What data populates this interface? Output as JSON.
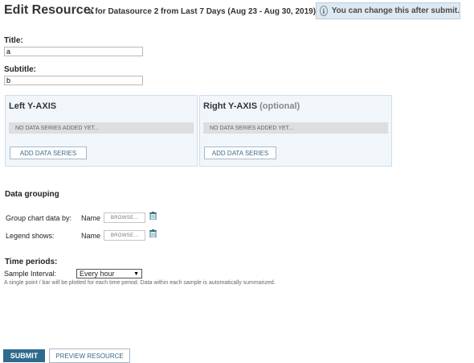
{
  "header": {
    "title": "Edit Resource:",
    "subtitle": "a for Datasource 2 from Last 7 Days (Aug 23 - Aug 30, 2019)",
    "info_text": "You can change this after submit.",
    "info_icon": "info-icon"
  },
  "form": {
    "title_label": "Title:",
    "title_value": "a",
    "subtitle_label": "Subtitle:",
    "subtitle_value": "b"
  },
  "axes": {
    "left": {
      "heading": "Left Y-AXIS",
      "empty_text": "No data series added yet...",
      "add_button": "ADD DATA SERIES"
    },
    "right": {
      "heading": "Right Y-AXIS",
      "optional": "(optional)",
      "empty_text": "No data series added yet...",
      "add_button": "ADD DATA SERIES"
    }
  },
  "grouping": {
    "heading": "Data grouping",
    "rows": [
      {
        "label": "Group chart data by:",
        "value": "Name",
        "browse": "BROWSE...",
        "icon": "trash-icon"
      },
      {
        "label": "Legend shows:",
        "value": "Name",
        "browse": "BROWSE...",
        "icon": "trash-icon"
      }
    ]
  },
  "time": {
    "heading": "Time periods:",
    "interval_label": "Sample Interval:",
    "interval_value": "Every hour",
    "help": "A single point / bar will be plotted for each time period. Data within each sample is automatically summarized."
  },
  "footer": {
    "submit": "SUBMIT",
    "preview": "PREVIEW RESOURCE"
  },
  "colors": {
    "accent": "#2e6a8d",
    "panel_bg": "#f1f6fb",
    "info_bg": "#dde9f2"
  }
}
